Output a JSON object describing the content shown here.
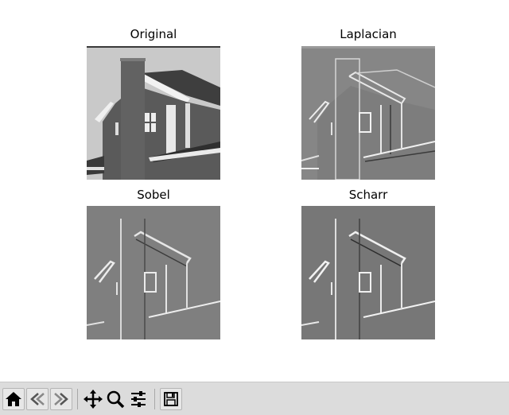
{
  "panels": [
    {
      "title": "Original"
    },
    {
      "title": "Laplacian"
    },
    {
      "title": "Sobel"
    },
    {
      "title": "Scharr"
    }
  ],
  "toolbar": {
    "buttons": [
      {
        "icon": "home-icon"
      },
      {
        "icon": "back-arrow-icon"
      },
      {
        "icon": "forward-arrow-icon"
      },
      {
        "icon": "pan-move-icon"
      },
      {
        "icon": "zoom-magnifier-icon"
      },
      {
        "icon": "configure-subplots-icon"
      },
      {
        "icon": "save-floppy-icon"
      }
    ]
  },
  "colors": {
    "toolbar_bg": "#dcdcdc",
    "filtered_gray": "#7f7f7f",
    "sky": "#c6c6c6",
    "brick": "#5c5c5c"
  }
}
